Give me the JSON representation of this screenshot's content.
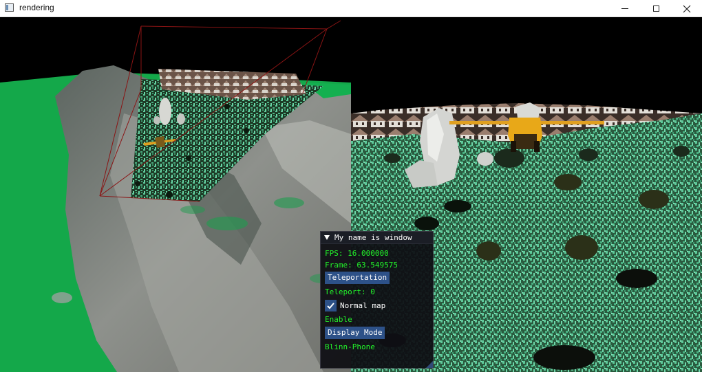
{
  "window": {
    "title": "rendering",
    "controls": [
      "minimize",
      "maximize",
      "close"
    ]
  },
  "scene": {
    "left_viewport": "terrain-overview",
    "right_viewport": "ground-camera"
  },
  "panel": {
    "title": "My name is window",
    "fps": "FPS: 16.000000",
    "frame": "Frame: 63.549575",
    "teleport_button": "Teleportation",
    "teleport_value": "Teleport: 0",
    "normal_map_label": "Normal map",
    "normal_map_checked": true,
    "enable_label": "Enable",
    "display_mode_button": "Display Mode",
    "display_mode_value": "Blinn-Phone"
  },
  "colors": {
    "text_green": "#22f22a",
    "button_blue": "#2d5188",
    "panel_bg": "#0f0f14",
    "frustum_red": "#8a1414",
    "grass": "#5ec99a",
    "terrain_green": "#14a84a"
  },
  "icons": {
    "app": "app-window-icon",
    "collapse": "collapse-triangle-icon",
    "check": "checkmark-icon"
  }
}
